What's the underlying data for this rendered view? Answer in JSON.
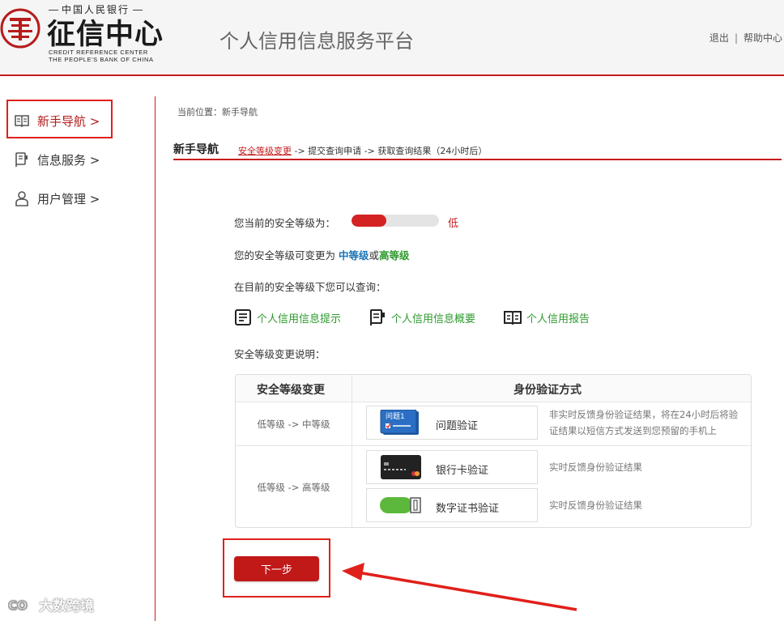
{
  "header": {
    "logo_top": "中国人民银行",
    "logo_main": "征信中心",
    "logo_en_line1": "CREDIT REFERENCE CENTER",
    "logo_en_line2": "THE PEOPLE'S BANK OF CHINA",
    "platform_title": "个人信用信息服务平台",
    "links": {
      "logout": "退出",
      "separator": "|",
      "help": "帮助中心"
    },
    "accent_color": "#c71b1b"
  },
  "sidebar": {
    "items": [
      {
        "label": "新手导航 >",
        "icon": "book-icon",
        "active": true
      },
      {
        "label": "信息服务 >",
        "icon": "document-icon",
        "active": false
      },
      {
        "label": "用户管理 >",
        "icon": "user-icon",
        "active": false
      }
    ]
  },
  "main": {
    "breadcrumb": "当前位置：新手导航",
    "section_title": "新手导航",
    "steps": {
      "current": "安全等级变更",
      "rest": " -> 提交查询申请 -> 获取查询结果（24小时后）"
    },
    "security": {
      "label": "您当前的安全等级为：",
      "level_fraction": 0.4,
      "level_text": "低",
      "change_prefix": "您的安全等级可变更为 ",
      "medium": "中等级",
      "or": "或",
      "high": "高等级",
      "query_intro": "在目前的安全等级下您可以查询："
    },
    "query_links": [
      {
        "label": "个人信用信息提示",
        "icon": "list-document-icon"
      },
      {
        "label": "个人信用信息概要",
        "icon": "document-icon"
      },
      {
        "label": "个人信用报告",
        "icon": "book-icon"
      }
    ],
    "change_note": "安全等级变更说明：",
    "table": {
      "headers": [
        "安全等级变更",
        "身份验证方式"
      ],
      "rows": [
        {
          "level": "低等级 -> 中等级",
          "methods": [
            {
              "name": "问题验证",
              "image": "question-card",
              "image_text": "问题1",
              "description": "非实时反馈身份验证结果，将在24小时后将验证结果以短信方式发送到您预留的手机上"
            }
          ]
        },
        {
          "level": "低等级 -> 高等级",
          "methods": [
            {
              "name": "银行卡验证",
              "image": "bank-card",
              "description": "实时反馈身份验证结果"
            },
            {
              "name": "数字证书验证",
              "image": "usb-key",
              "description": "实时反馈身份验证结果"
            }
          ]
        }
      ]
    },
    "next_button": "下一步"
  },
  "watermark": {
    "text": "大数跨境",
    "logo_text": "CO"
  }
}
